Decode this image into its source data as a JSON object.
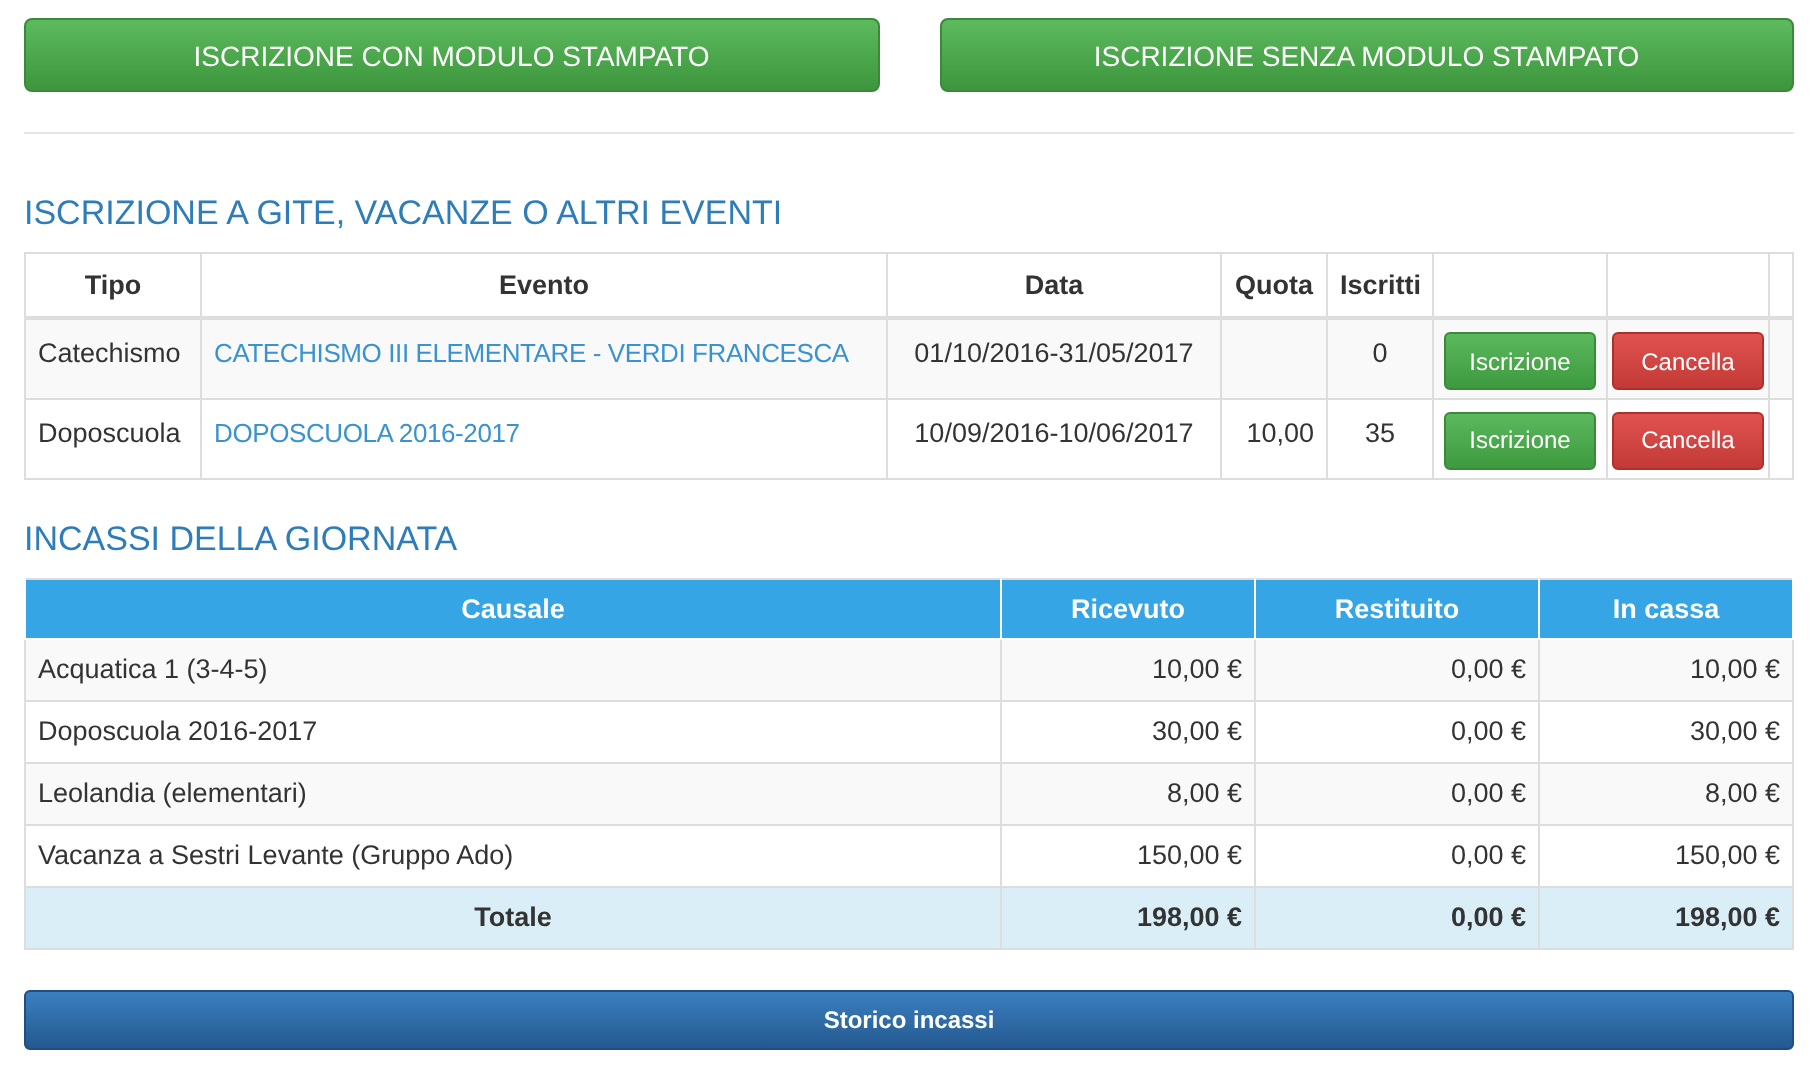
{
  "top_buttons": [
    {
      "label": "ISCRIZIONE CON MODULO STAMPATO"
    },
    {
      "label": "ISCRIZIONE SENZA MODULO STAMPATO"
    }
  ],
  "events": {
    "title": "ISCRIZIONE A GITE, VACANZE O ALTRI EVENTI",
    "columns": [
      "Tipo",
      "Evento",
      "Data",
      "Quota",
      "Iscritti"
    ],
    "rows": [
      {
        "tipo": "Catechismo",
        "evento": "CATECHISMO III ELEMENTARE - VERDI FRANCESCA",
        "data": "01/10/2016-31/05/2017",
        "iscritti": "0",
        "actions": [
          {
            "kind": "enroll",
            "label": "Iscrizione"
          },
          {
            "kind": "cancel",
            "label": "Cancella"
          }
        ]
      },
      {
        "tipo": "Doposcuola",
        "evento": "DOPOSCUOLA 2016-2017",
        "data": "10/09/2016-10/06/2017",
        "quota": "10,00",
        "iscritti": "35",
        "actions": [
          {
            "kind": "enroll",
            "label": "Iscrizione"
          },
          {
            "kind": "cancel",
            "label": "Cancella"
          }
        ]
      }
    ]
  },
  "receipts": {
    "title": "INCASSI DELLA GIORNATA",
    "columns": [
      "Causale",
      "Ricevuto",
      "Restituito",
      "In cassa"
    ],
    "rows": [
      {
        "causale": "Acquatica 1 (3-4-5)",
        "ricevuto": "10,00 €",
        "restituito": "0,00 €",
        "in_cassa": "10,00 €"
      },
      {
        "causale": "Doposcuola 2016-2017",
        "ricevuto": "30,00 €",
        "restituito": "0,00 €",
        "in_cassa": "30,00 €"
      },
      {
        "causale": "Leolandia (elementari)",
        "ricevuto": "8,00 €",
        "restituito": "0,00 €",
        "in_cassa": "8,00 €"
      },
      {
        "causale": "Vacanza a Sestri Levante (Gruppo Ado)",
        "ricevuto": "150,00 €",
        "restituito": "0,00 €",
        "in_cassa": "150,00 €"
      }
    ],
    "total": {
      "label": "Totale",
      "ricevuto": "198,00 €",
      "restituito": "0,00 €",
      "in_cassa": "198,00 €"
    }
  },
  "history_button": {
    "label": "Storico incassi"
  }
}
